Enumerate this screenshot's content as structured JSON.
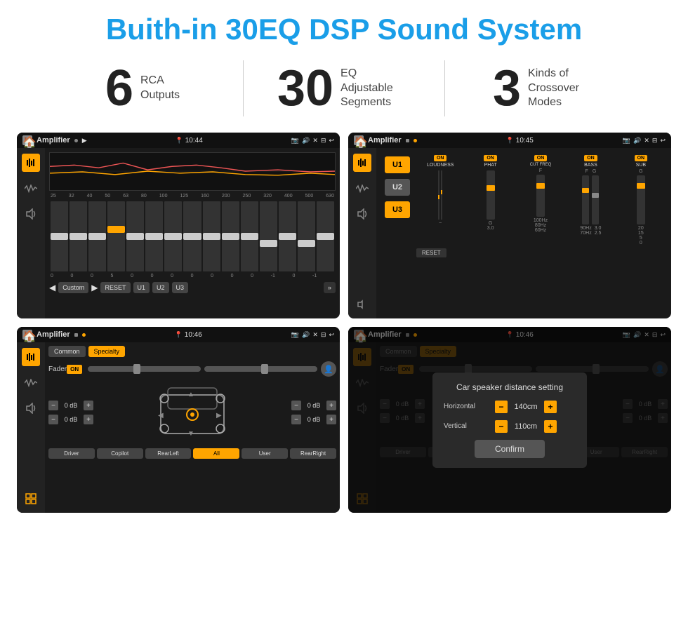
{
  "header": {
    "title": "Buith-in 30EQ DSP Sound System"
  },
  "stats": [
    {
      "number": "6",
      "label_line1": "RCA",
      "label_line2": "Outputs"
    },
    {
      "number": "30",
      "label_line1": "EQ Adjustable",
      "label_line2": "Segments"
    },
    {
      "number": "3",
      "label_line1": "Kinds of",
      "label_line2": "Crossover Modes"
    }
  ],
  "screens": [
    {
      "id": "screen1",
      "status_app": "Amplifier",
      "status_time": "10:44",
      "eq_freqs": [
        "25",
        "32",
        "40",
        "50",
        "63",
        "80",
        "100",
        "125",
        "160",
        "200",
        "250",
        "320",
        "400",
        "500",
        "630"
      ],
      "eq_values": [
        "0",
        "0",
        "0",
        "5",
        "0",
        "0",
        "0",
        "0",
        "0",
        "0",
        "0",
        "-1",
        "0",
        "-1"
      ],
      "preset": "Custom",
      "buttons": [
        "RESET",
        "U1",
        "U2",
        "U3"
      ]
    },
    {
      "id": "screen2",
      "status_app": "Amplifier",
      "status_time": "10:45",
      "u_buttons": [
        "U1",
        "U2",
        "U3"
      ],
      "controls": [
        "LOUDNESS",
        "PHAT",
        "CUT FREQ",
        "BASS",
        "SUB"
      ],
      "reset_label": "RESET"
    },
    {
      "id": "screen3",
      "status_app": "Amplifier",
      "status_time": "10:46",
      "tabs": [
        "Common",
        "Specialty"
      ],
      "active_tab": "Specialty",
      "fader_label": "Fader",
      "fader_on": "ON",
      "vol_labels": [
        "0 dB",
        "0 dB",
        "0 dB",
        "0 dB"
      ],
      "bottom_buttons": [
        "Driver",
        "Copilot",
        "RearLeft",
        "All",
        "User",
        "RearRight"
      ]
    },
    {
      "id": "screen4",
      "status_app": "Amplifier",
      "status_time": "10:46",
      "tabs": [
        "Common",
        "Specialty"
      ],
      "dialog_title": "Car speaker distance setting",
      "horizontal_label": "Horizontal",
      "horizontal_value": "140cm",
      "vertical_label": "Vertical",
      "vertical_value": "110cm",
      "confirm_label": "Confirm",
      "bottom_buttons": [
        "Driver",
        "Copilot",
        "RearLeft",
        "All",
        "User",
        "RearRight"
      ]
    }
  ]
}
